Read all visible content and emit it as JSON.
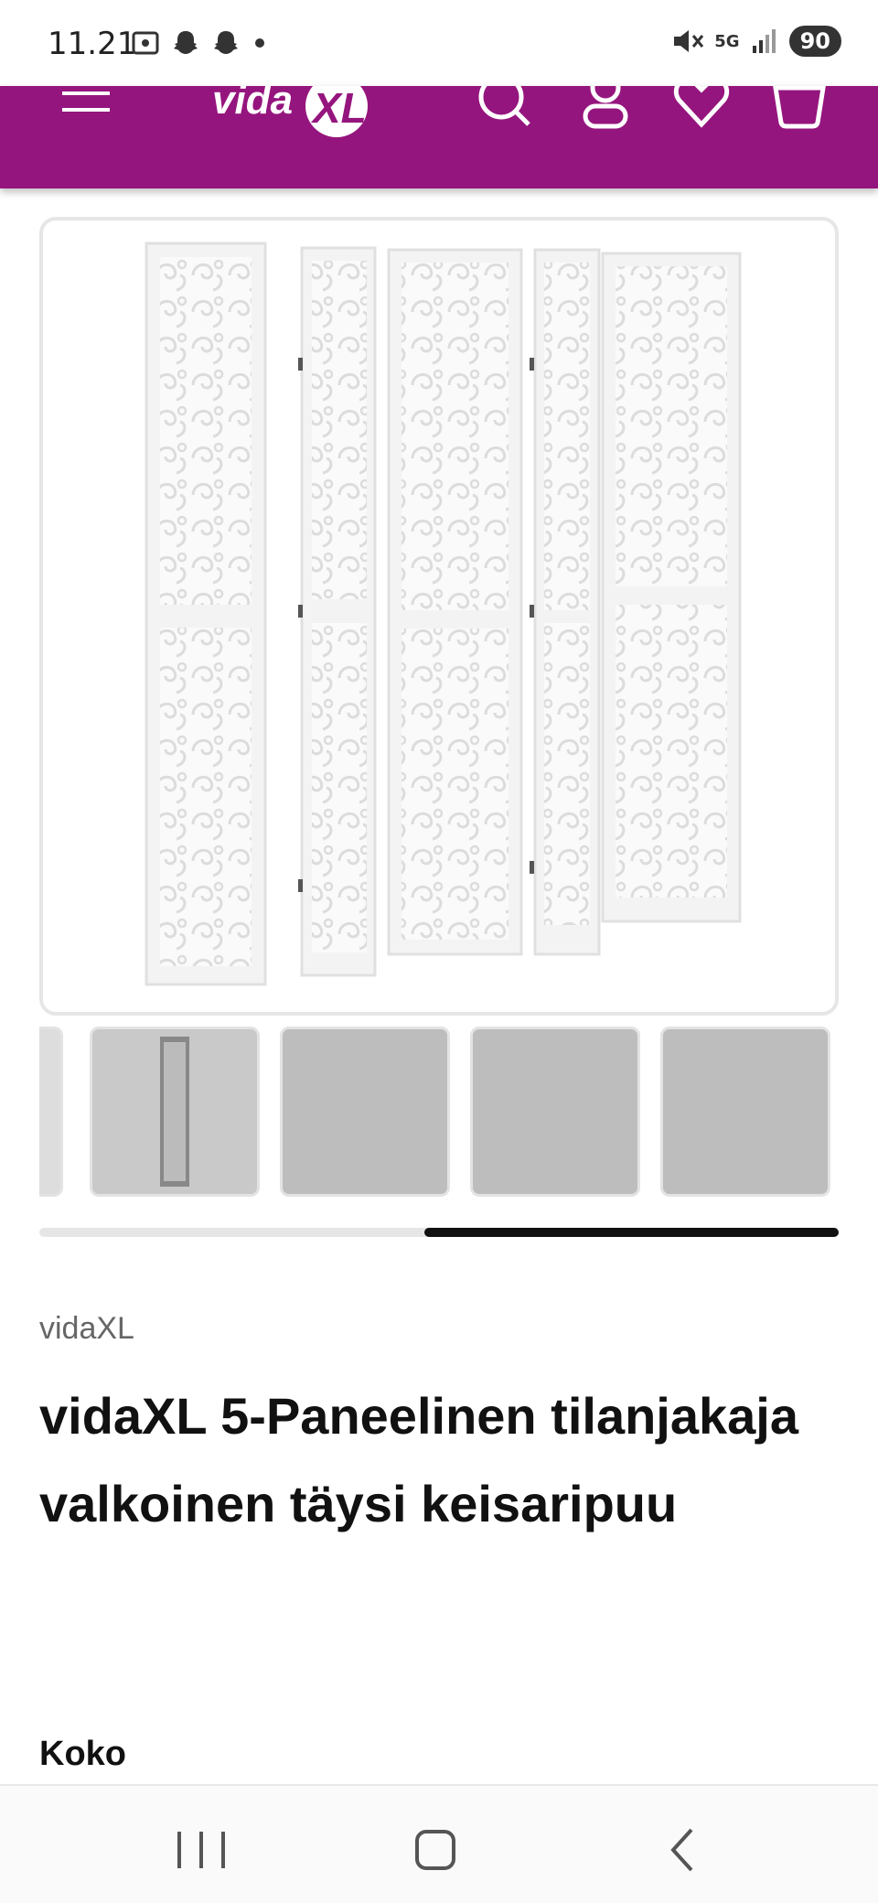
{
  "status_bar": {
    "time": "11.21",
    "battery": "90",
    "network": "5G",
    "icons_left": [
      "screenshot-icon",
      "snapchat-icon",
      "snapchat-icon",
      "dot-icon"
    ],
    "icons_right": [
      "mute-icon",
      "5g-icon",
      "signal-icon",
      "battery-icon"
    ]
  },
  "header": {
    "background": "#95157e",
    "logo_text": "vidaXL",
    "icons": [
      "menu-icon",
      "search-icon",
      "account-icon",
      "heart-icon",
      "cart-icon"
    ]
  },
  "gallery": {
    "main_image_alt": "5-panel white carved room divider",
    "thumbnail_count": 5,
    "scroll_position": 0.52
  },
  "product": {
    "brand": "vidaXL",
    "title": "vidaXL 5-Paneelinen tilanjakaja valkoinen täysi keisaripuu",
    "size_label": "Koko"
  },
  "nav": {
    "icons": [
      "recent-apps-icon",
      "home-icon",
      "back-icon"
    ]
  }
}
